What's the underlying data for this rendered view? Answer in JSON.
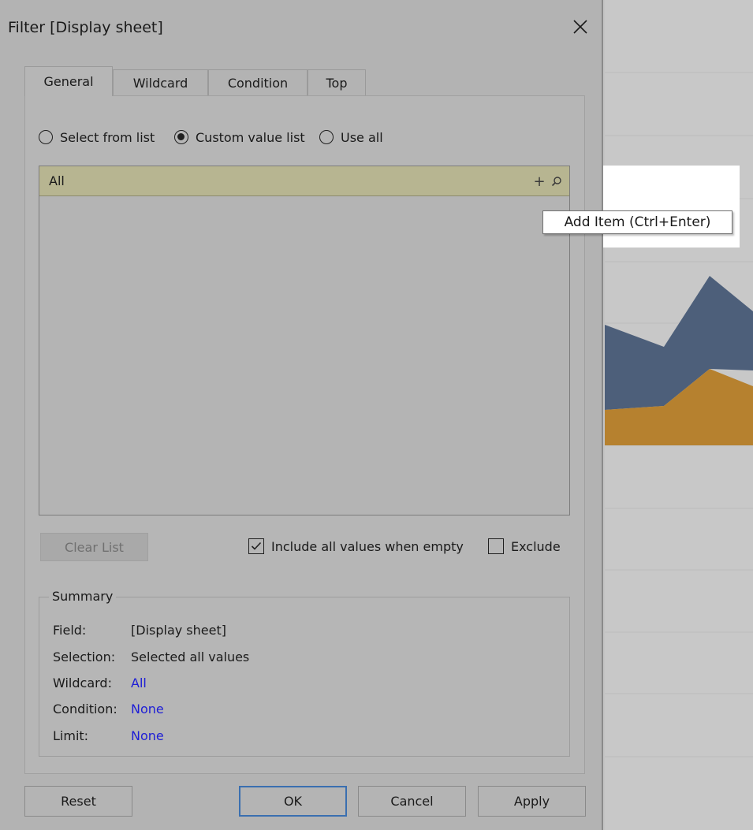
{
  "dialog": {
    "title": "Filter [Display sheet]",
    "close_icon": "close-icon"
  },
  "tabs": [
    {
      "label": "General",
      "active": true
    },
    {
      "label": "Wildcard",
      "active": false
    },
    {
      "label": "Condition",
      "active": false
    },
    {
      "label": "Top",
      "active": false
    }
  ],
  "radios": [
    {
      "label": "Select from list",
      "checked": false
    },
    {
      "label": "Custom value list",
      "checked": true
    },
    {
      "label": "Use all",
      "checked": false
    }
  ],
  "value_list": {
    "rows": [
      "All"
    ],
    "add_icon": "plus-icon",
    "search_icon": "search-icon"
  },
  "tooltip": "Add Item (Ctrl+Enter)",
  "clear_list_label": "Clear List",
  "checkboxes": [
    {
      "label": "Include all values when empty",
      "checked": true
    },
    {
      "label": "Exclude",
      "checked": false
    }
  ],
  "summary": {
    "legend": "Summary",
    "rows": [
      {
        "label": "Field:",
        "value": "[Display sheet]",
        "highlight": false
      },
      {
        "label": "Selection:",
        "value": "Selected all values",
        "highlight": false
      },
      {
        "label": "Wildcard:",
        "value": "All",
        "highlight": true
      },
      {
        "label": "Condition:",
        "value": "None",
        "highlight": true
      },
      {
        "label": "Limit:",
        "value": "None",
        "highlight": true
      }
    ]
  },
  "buttons": {
    "reset": "Reset",
    "ok": "OK",
    "cancel": "Cancel",
    "apply": "Apply"
  },
  "colors": {
    "area_blue": "#4d5f7a",
    "area_orange": "#b6812f",
    "list_row": "#b7b591",
    "link_blue": "#1d1dd6",
    "primary_border": "#3a6fb0"
  }
}
